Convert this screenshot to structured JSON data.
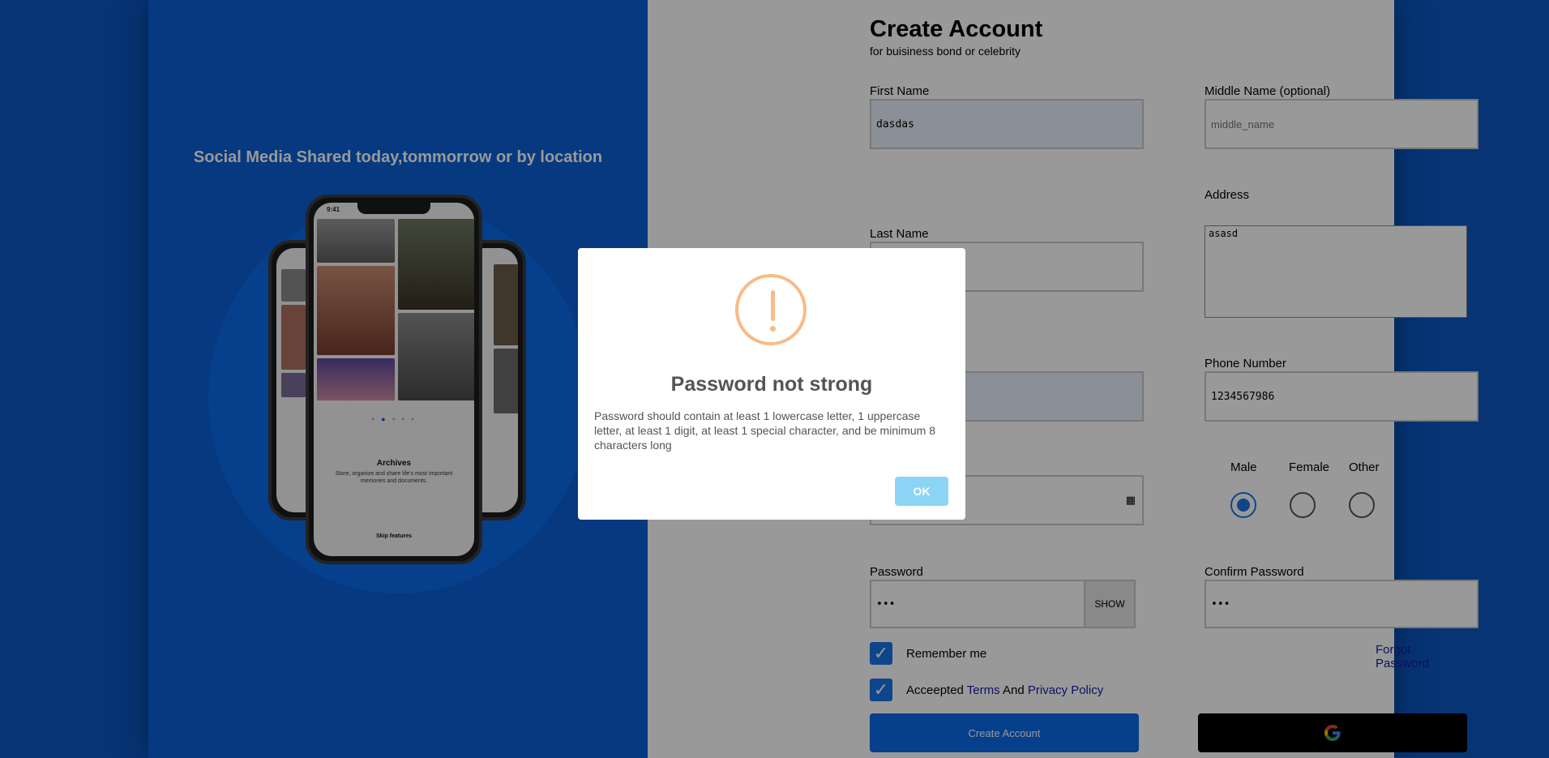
{
  "hero": {
    "tagline": "Social Media Shared today,tommorrow or by location",
    "phone": {
      "status_time": "9:41",
      "caption_title": "Archives",
      "caption_text": "Store, organize and share life's most important memories and documents.",
      "skip_label": "Skip features"
    }
  },
  "form": {
    "title": "Create Account",
    "subtitle": "for buisiness bond or celebrity",
    "first_name": {
      "label": "First Name",
      "value": "dasdas"
    },
    "middle_name": {
      "label": "Middle Name (optional)",
      "placeholder": "middle_name"
    },
    "last_name": {
      "label": "Last Name"
    },
    "address": {
      "label": "Address",
      "value": "asasd"
    },
    "phone": {
      "label": "Phone Number",
      "value": "1234567986"
    },
    "gender": {
      "options": [
        "Male",
        "Female",
        "Other"
      ],
      "selected": "Male"
    },
    "password": {
      "label": "Password",
      "value": "•••",
      "show_label": "SHOW"
    },
    "confirm_password": {
      "label": "Confirm Password",
      "value": "•••"
    },
    "remember_me": {
      "label": "Remember me",
      "checked": true
    },
    "accept": {
      "prefix": "Acceepted",
      "terms": "Terms",
      "and": "And",
      "privacy": "Privacy Policy",
      "checked": true
    },
    "forgot_password": "Forgot Password",
    "create_button": "Create Account",
    "google_icon": "google-icon"
  },
  "modal": {
    "icon": "warning-icon",
    "title": "Password not strong",
    "message": "Password should contain at least 1 lowercase letter, 1 uppercase letter, at least 1 digit, at least 1 special character, and be minimum 8 characters long",
    "ok_label": "OK"
  },
  "colors": {
    "brand_blue": "#0a5fd6",
    "warning": "#f8bb86",
    "ok_button": "#8cd4f5"
  }
}
